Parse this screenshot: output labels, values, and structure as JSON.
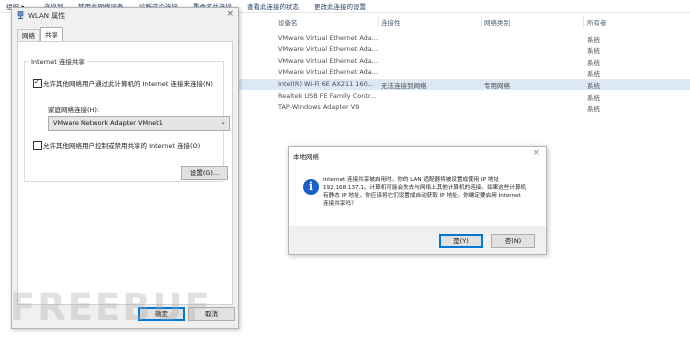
{
  "background_window": {
    "toolbar": [
      "组织 ▾",
      "连接到",
      "禁用此网络设备",
      "诊断这个连接",
      "重命名此连接",
      "查看此连接的状态",
      "更改此连接的设置"
    ],
    "columns": [
      "设备名",
      "连接性",
      "网络类别",
      "所有者"
    ],
    "rows": [
      {
        "device": "VMware Virtual Ethernet Ada...",
        "connectivity": "",
        "category": "",
        "owner": "系统"
      },
      {
        "device": "VMware Virtual Ethernet Ada...",
        "connectivity": "",
        "category": "",
        "owner": "系统"
      },
      {
        "device": "VMware Virtual Ethernet Ada...",
        "connectivity": "",
        "category": "",
        "owner": "系统"
      },
      {
        "device": "VMware Virtual Ethernet Ada...",
        "connectivity": "",
        "category": "",
        "owner": "系统"
      },
      {
        "device": "Intel(R) Wi-Fi 6E AX211 160...",
        "connectivity": "无法连接到网络",
        "category": "专用网络",
        "owner": "系统"
      },
      {
        "device": "Realtek USB FE Family Contr...",
        "connectivity": "",
        "category": "",
        "owner": "系统"
      },
      {
        "device": "TAP-Windows Adapter V9",
        "connectivity": "",
        "category": "",
        "owner": "系统"
      }
    ]
  },
  "wlan_dialog": {
    "title": "WLAN 属性",
    "close": "×",
    "tabs": [
      "网络",
      "共享"
    ],
    "group_title": "Internet 连接共享",
    "allow_share_label": "允许其他网络用户通过此计算机的 Internet 连接来连接(N)",
    "home_network_label": "家庭网络连接(H):",
    "home_network_value": "VMware Network Adapter VMnet1",
    "allow_control_label": "允许其他网络用户控制或禁用共享的 Internet 连接(O)",
    "settings_button": "设置(G)...",
    "ok_button": "确定",
    "cancel_button": "取消"
  },
  "local_network_dialog": {
    "title": "本地网络",
    "close": "×",
    "message": "Internet 连接共享被启用时，你的 LAN 适配器将被设置成使用 IP 地址 192.168.137.1。计算机可能会失去与网络上其他计算机的连接。如果这些计算机有静态 IP 地址，你应该将它们设置成自动获取 IP 地址。你确定要启用 Internet 连接共享吗？",
    "yes_button": "是(Y)",
    "no_button": "否(N)"
  },
  "watermark": "FREEBUF"
}
